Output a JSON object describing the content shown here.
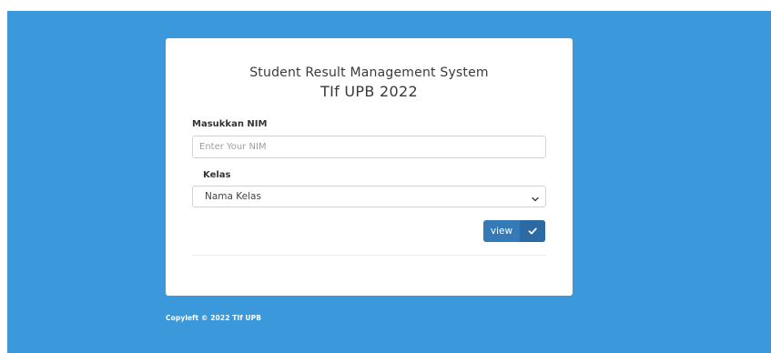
{
  "card": {
    "title_line1": "Student Result Management System",
    "title_line2": "TIf UPB 2022"
  },
  "form": {
    "nim_label": "Masukkan NIM",
    "nim_placeholder": "Enter Your NIM",
    "nim_value": "",
    "kelas_label": "Kelas",
    "kelas_selected": "Nama Kelas",
    "view_label": "view"
  },
  "footer": {
    "text": "Copyleft © 2022 TIf UPB"
  },
  "icons": {
    "select_arrow": "chevron-down-icon",
    "view_button": "check-icon"
  },
  "colors": {
    "background": "#3a98db",
    "button": "#337ab7",
    "button_icon_bg": "#2b6aa3"
  }
}
